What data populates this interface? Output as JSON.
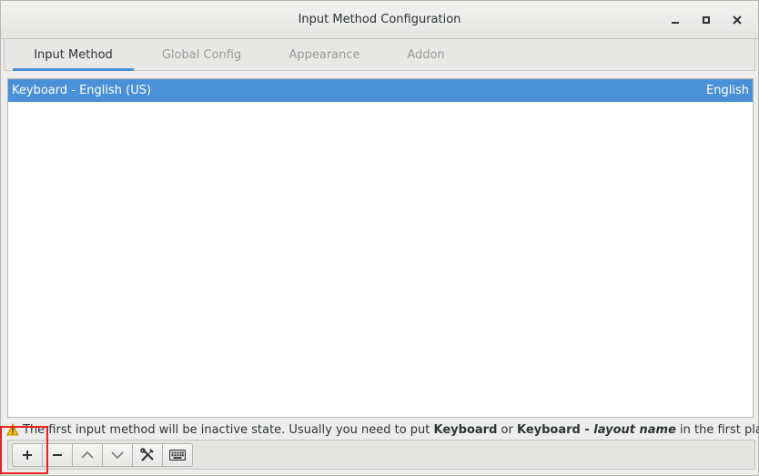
{
  "window": {
    "title": "Input Method Configuration"
  },
  "tabs": [
    {
      "label": "Input Method",
      "active": true
    },
    {
      "label": "Global Config",
      "active": false
    },
    {
      "label": "Appearance",
      "active": false
    },
    {
      "label": "Addon",
      "active": false
    }
  ],
  "input_methods": [
    {
      "name": "Keyboard - English (US)",
      "language": "English",
      "selected": true
    }
  ],
  "hint": {
    "text_before": "The first input method will be inactive state. Usually you need to put ",
    "bold1": "Keyboard",
    "text_mid": " or ",
    "bold2": "Keyboard - ",
    "italic": "layout name",
    "text_after": " in the first place."
  },
  "toolbar": {
    "add_label": "+",
    "remove_label": "−",
    "up_label": "^",
    "down_label": "v",
    "icons": [
      "plus-icon",
      "minus-icon",
      "chevron-up-icon",
      "chevron-down-icon",
      "tools-icon",
      "keyboard-icon"
    ]
  },
  "colors": {
    "selection": "#4a90d9",
    "highlight_box": "#e8211e"
  }
}
